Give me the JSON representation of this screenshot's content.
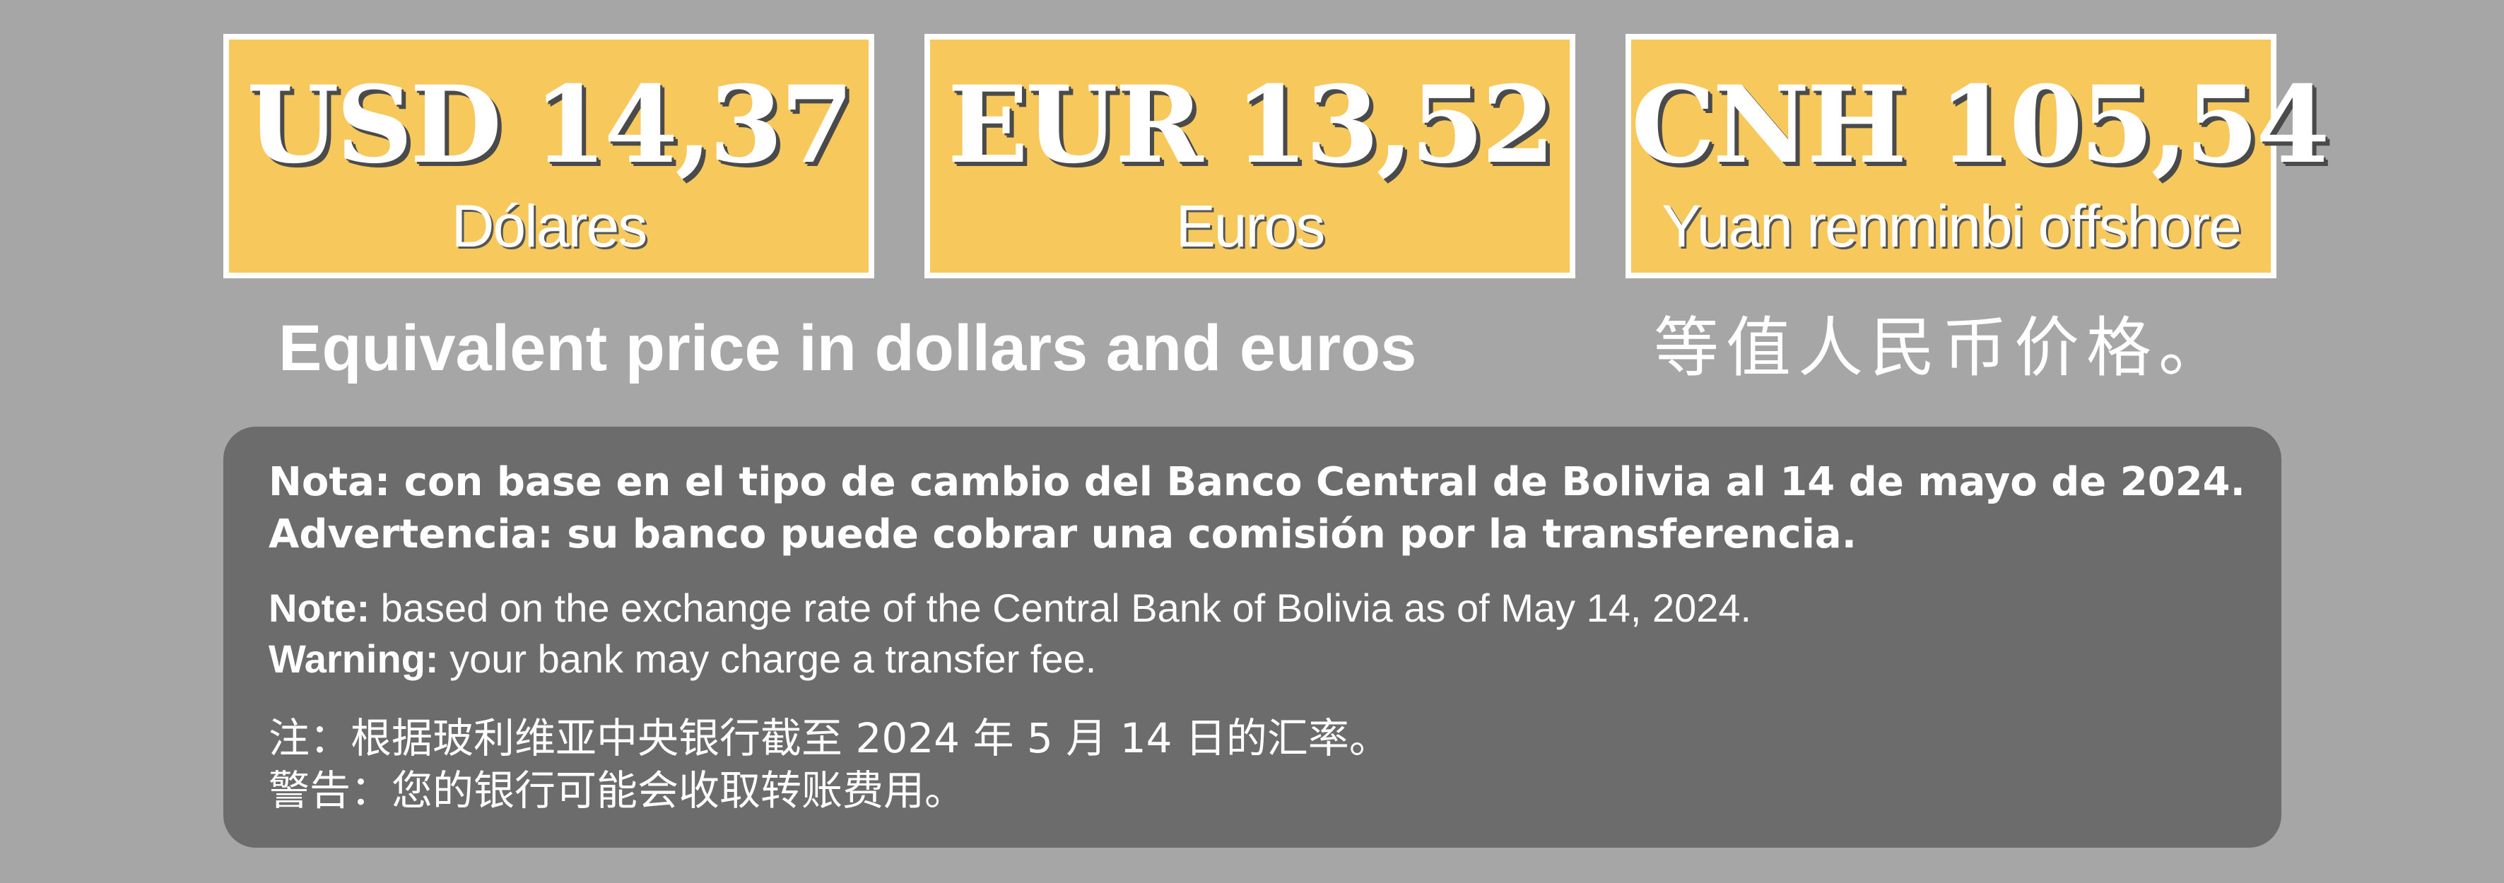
{
  "prices": [
    {
      "currency": "USD",
      "amount": "14,37",
      "display": "USD 14,37",
      "label": "Dólares"
    },
    {
      "currency": "EUR",
      "amount": "13,52",
      "display": "EUR 13,52",
      "label": "Euros"
    },
    {
      "currency": "CNH",
      "amount": "105,54",
      "display": "CNH 105,54",
      "label": "Yuan renminbi offshore"
    }
  ],
  "subtitle": {
    "en": "Equivalent price in dollars and euros",
    "zh": "等值人民币价格。"
  },
  "notes": {
    "es_nota": "Nota: con base en el tipo de cambio del Banco Central de Bolivia al 14 de mayo de 2024.",
    "es_advertencia": "Advertencia: su banco puede cobrar una comisión por la transferencia.",
    "en_note_label": "Note:",
    "en_note_text": " based on the exchange rate of the Central Bank of Bolivia as of May 14, 2024.",
    "en_warning_label": "Warning:",
    "en_warning_text": " your bank may charge a transfer fee.",
    "zh_note": "注：根据玻利维亚中央银行截至 2024 年 5 月 14 日的汇率。",
    "zh_warning": "警告：您的银行可能会收取转账费用。"
  },
  "colors": {
    "background": "#a6a6a6",
    "price_box": "#f7c95c",
    "note_box": "#6c6c6c",
    "text": "#ffffff"
  }
}
